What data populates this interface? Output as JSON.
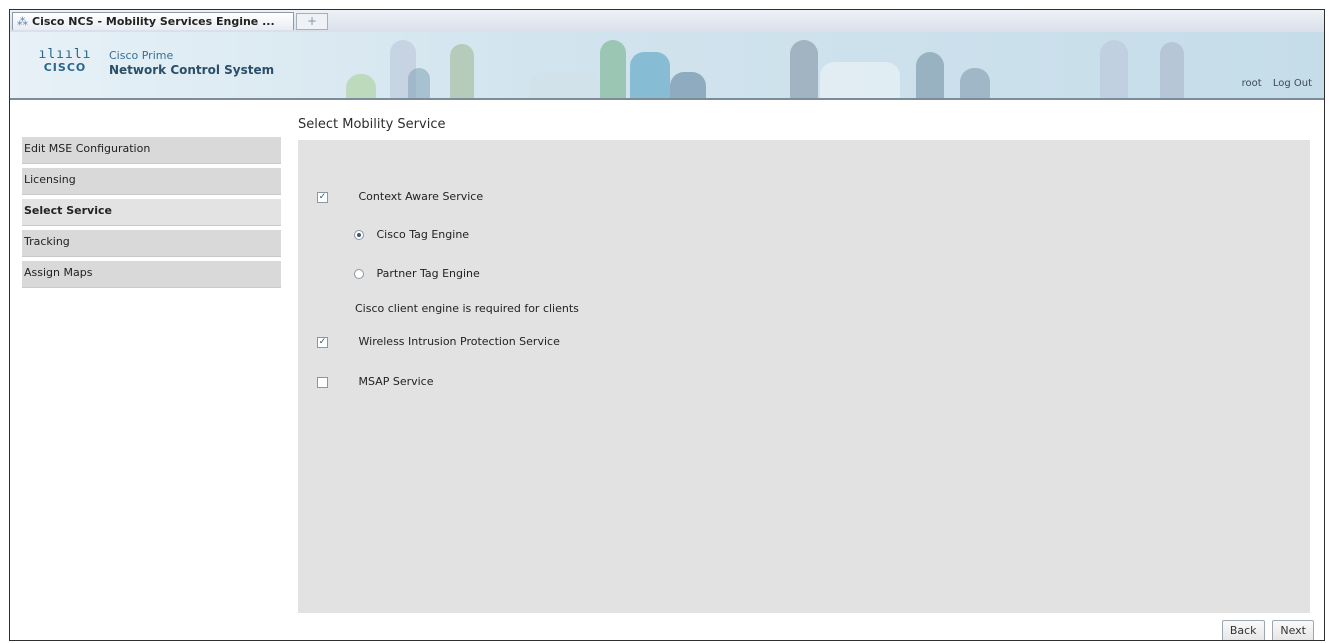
{
  "browser": {
    "tab_title": "Cisco NCS - Mobility Services Engine ...",
    "tab_icon": "cisco-icon",
    "new_tab_glyph": "+"
  },
  "header": {
    "logo_bars": "ılıılı",
    "logo_text": "CISCO",
    "product_line1": "Cisco Prime",
    "product_line2": "Network Control System",
    "user": "root",
    "logout": "Log Out"
  },
  "sidebar": {
    "items": [
      {
        "label": "Edit MSE Configuration",
        "active": false
      },
      {
        "label": "Licensing",
        "active": false
      },
      {
        "label": "Select Service",
        "active": true
      },
      {
        "label": "Tracking",
        "active": false
      },
      {
        "label": "Assign Maps",
        "active": false
      }
    ]
  },
  "main": {
    "title": "Select Mobility Service",
    "context_aware": {
      "label": "Context Aware Service",
      "checked": true
    },
    "cisco_tag_engine": {
      "label": "Cisco Tag Engine",
      "selected": true
    },
    "partner_tag_engine": {
      "label": "Partner Tag Engine",
      "selected": false
    },
    "note": "Cisco client engine is required for clients",
    "wips": {
      "label": "Wireless Intrusion Protection Service",
      "checked": true
    },
    "msap": {
      "label": "MSAP Service",
      "checked": false
    },
    "check_glyph": "✓"
  },
  "footer": {
    "back_label": "Back",
    "next_label": "Next"
  },
  "colors": {
    "panel_bg": "#e2e2e2",
    "nav_bg": "#d9d9d9",
    "brand_blue": "#29658d"
  }
}
